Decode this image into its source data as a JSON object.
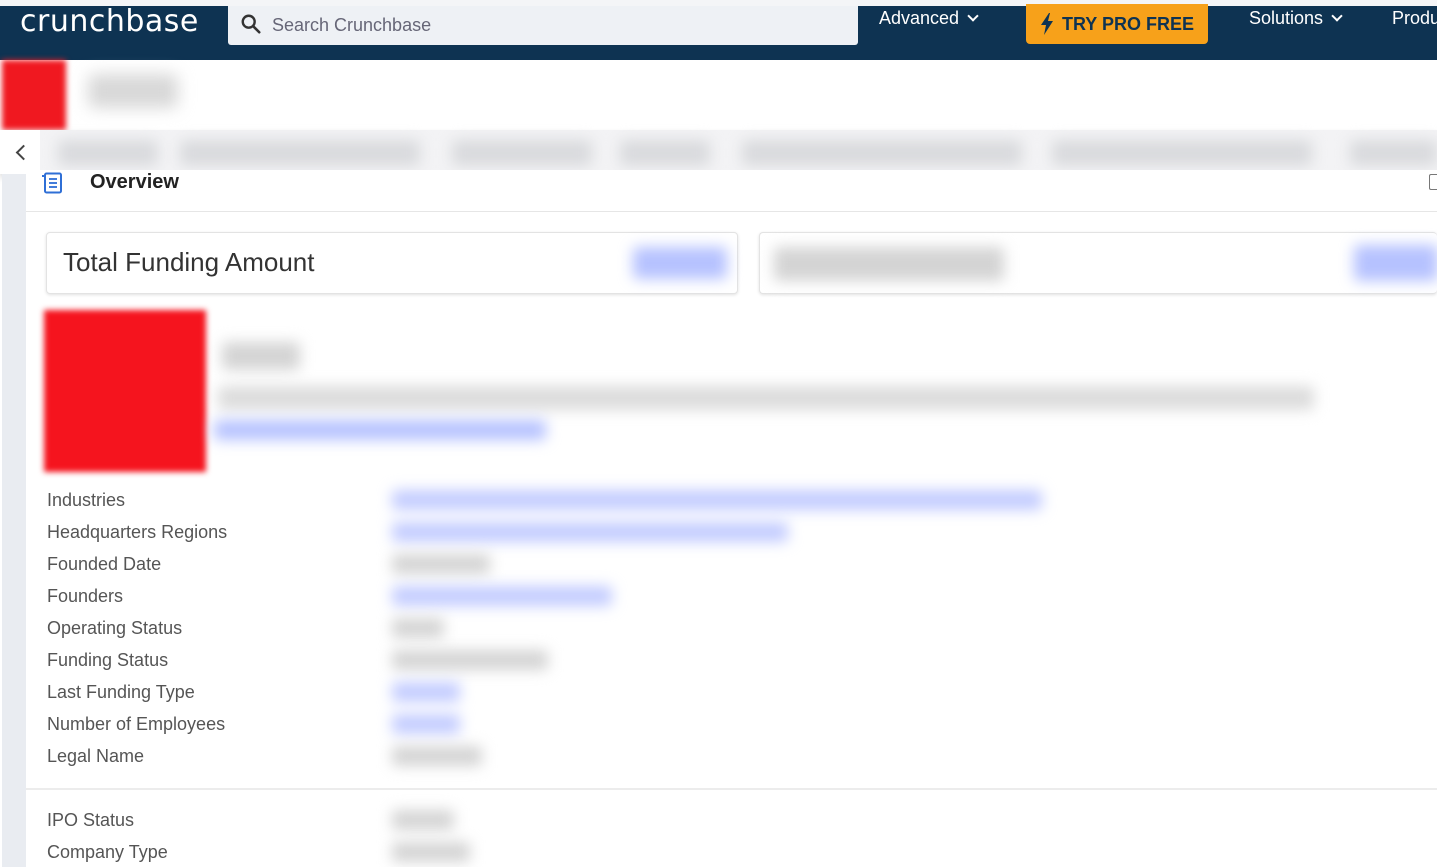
{
  "topbar": {
    "logo_text": "crunchbase",
    "search_placeholder": "Search Crunchbase",
    "advanced_label": "Advanced",
    "pro_label": "TRY PRO FREE",
    "solutions_label": "Solutions",
    "products_label": "Produ",
    "colors": {
      "bar": "#0e3352",
      "pro_button": "#f7a11a"
    }
  },
  "overview": {
    "title": "Overview",
    "icon": "document-list-icon"
  },
  "cards": {
    "total_funding_label": "Total Funding Amount"
  },
  "details": {
    "primary": [
      "Industries",
      "Headquarters Regions",
      "Founded Date",
      "Founders",
      "Operating Status",
      "Funding Status",
      "Last Funding Type",
      "Number of Employees",
      "Legal Name"
    ],
    "secondary": [
      "IPO Status",
      "Company Type"
    ]
  }
}
